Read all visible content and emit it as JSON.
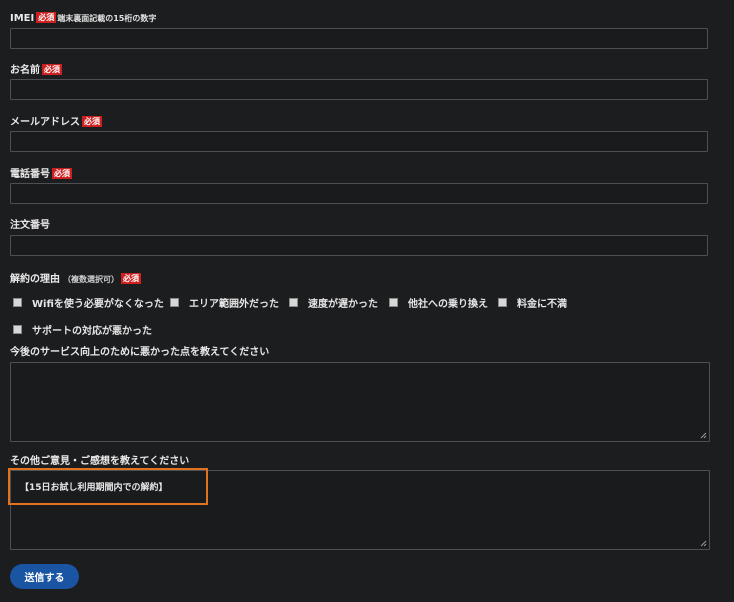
{
  "required_badge": "必須",
  "fields": {
    "imei": {
      "label": "IMEI",
      "note": "端末裏面記載の15桁の数字",
      "value": ""
    },
    "name": {
      "label": "お名前",
      "value": ""
    },
    "email": {
      "label": "メールアドレス",
      "value": ""
    },
    "phone": {
      "label": "電話番号",
      "value": ""
    },
    "order": {
      "label": "注文番号",
      "value": ""
    }
  },
  "cancel_reason": {
    "label": "解約の理由",
    "sub": "（複数選択可）",
    "options": [
      {
        "label": "Wifiを使う必要がなくなった",
        "checked": false
      },
      {
        "label": "エリア範囲外だった",
        "checked": false
      },
      {
        "label": "速度が遅かった",
        "checked": false
      },
      {
        "label": "他社への乗り換え",
        "checked": false
      },
      {
        "label": "料金に不満",
        "checked": false
      },
      {
        "label": "サポートの対応が悪かった",
        "checked": false
      }
    ]
  },
  "improvement": {
    "label": "今後のサービス向上のために悪かった点を教えてください",
    "value": ""
  },
  "other": {
    "label": "その他ご意見・ご感想を教えてください",
    "value": "【15日お試し利用期間内での解約】"
  },
  "submit_label": "送信する",
  "colors": {
    "background": "#1c1d1f",
    "required": "#cc1f1f",
    "submit": "#1a55a3",
    "highlight": "#e0731f"
  }
}
